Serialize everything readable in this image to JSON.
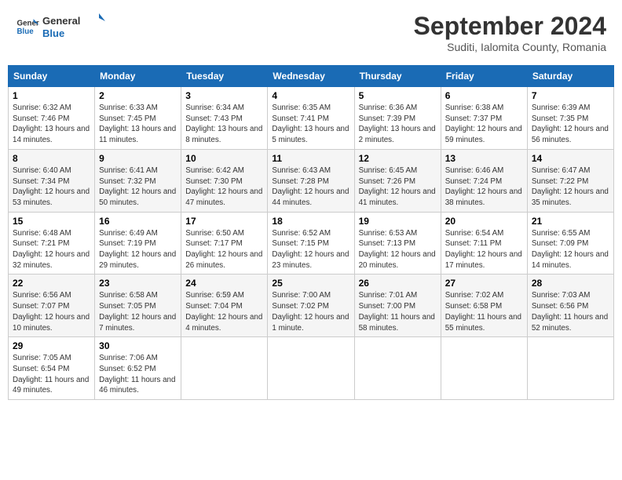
{
  "header": {
    "logo_general": "General",
    "logo_blue": "Blue",
    "month_title": "September 2024",
    "subtitle": "Suditi, Ialomita County, Romania"
  },
  "days_of_week": [
    "Sunday",
    "Monday",
    "Tuesday",
    "Wednesday",
    "Thursday",
    "Friday",
    "Saturday"
  ],
  "weeks": [
    [
      {
        "day": "1",
        "info": "Sunrise: 6:32 AM\nSunset: 7:46 PM\nDaylight: 13 hours and 14 minutes."
      },
      {
        "day": "2",
        "info": "Sunrise: 6:33 AM\nSunset: 7:45 PM\nDaylight: 13 hours and 11 minutes."
      },
      {
        "day": "3",
        "info": "Sunrise: 6:34 AM\nSunset: 7:43 PM\nDaylight: 13 hours and 8 minutes."
      },
      {
        "day": "4",
        "info": "Sunrise: 6:35 AM\nSunset: 7:41 PM\nDaylight: 13 hours and 5 minutes."
      },
      {
        "day": "5",
        "info": "Sunrise: 6:36 AM\nSunset: 7:39 PM\nDaylight: 13 hours and 2 minutes."
      },
      {
        "day": "6",
        "info": "Sunrise: 6:38 AM\nSunset: 7:37 PM\nDaylight: 12 hours and 59 minutes."
      },
      {
        "day": "7",
        "info": "Sunrise: 6:39 AM\nSunset: 7:35 PM\nDaylight: 12 hours and 56 minutes."
      }
    ],
    [
      {
        "day": "8",
        "info": "Sunrise: 6:40 AM\nSunset: 7:34 PM\nDaylight: 12 hours and 53 minutes."
      },
      {
        "day": "9",
        "info": "Sunrise: 6:41 AM\nSunset: 7:32 PM\nDaylight: 12 hours and 50 minutes."
      },
      {
        "day": "10",
        "info": "Sunrise: 6:42 AM\nSunset: 7:30 PM\nDaylight: 12 hours and 47 minutes."
      },
      {
        "day": "11",
        "info": "Sunrise: 6:43 AM\nSunset: 7:28 PM\nDaylight: 12 hours and 44 minutes."
      },
      {
        "day": "12",
        "info": "Sunrise: 6:45 AM\nSunset: 7:26 PM\nDaylight: 12 hours and 41 minutes."
      },
      {
        "day": "13",
        "info": "Sunrise: 6:46 AM\nSunset: 7:24 PM\nDaylight: 12 hours and 38 minutes."
      },
      {
        "day": "14",
        "info": "Sunrise: 6:47 AM\nSunset: 7:22 PM\nDaylight: 12 hours and 35 minutes."
      }
    ],
    [
      {
        "day": "15",
        "info": "Sunrise: 6:48 AM\nSunset: 7:21 PM\nDaylight: 12 hours and 32 minutes."
      },
      {
        "day": "16",
        "info": "Sunrise: 6:49 AM\nSunset: 7:19 PM\nDaylight: 12 hours and 29 minutes."
      },
      {
        "day": "17",
        "info": "Sunrise: 6:50 AM\nSunset: 7:17 PM\nDaylight: 12 hours and 26 minutes."
      },
      {
        "day": "18",
        "info": "Sunrise: 6:52 AM\nSunset: 7:15 PM\nDaylight: 12 hours and 23 minutes."
      },
      {
        "day": "19",
        "info": "Sunrise: 6:53 AM\nSunset: 7:13 PM\nDaylight: 12 hours and 20 minutes."
      },
      {
        "day": "20",
        "info": "Sunrise: 6:54 AM\nSunset: 7:11 PM\nDaylight: 12 hours and 17 minutes."
      },
      {
        "day": "21",
        "info": "Sunrise: 6:55 AM\nSunset: 7:09 PM\nDaylight: 12 hours and 14 minutes."
      }
    ],
    [
      {
        "day": "22",
        "info": "Sunrise: 6:56 AM\nSunset: 7:07 PM\nDaylight: 12 hours and 10 minutes."
      },
      {
        "day": "23",
        "info": "Sunrise: 6:58 AM\nSunset: 7:05 PM\nDaylight: 12 hours and 7 minutes."
      },
      {
        "day": "24",
        "info": "Sunrise: 6:59 AM\nSunset: 7:04 PM\nDaylight: 12 hours and 4 minutes."
      },
      {
        "day": "25",
        "info": "Sunrise: 7:00 AM\nSunset: 7:02 PM\nDaylight: 12 hours and 1 minute."
      },
      {
        "day": "26",
        "info": "Sunrise: 7:01 AM\nSunset: 7:00 PM\nDaylight: 11 hours and 58 minutes."
      },
      {
        "day": "27",
        "info": "Sunrise: 7:02 AM\nSunset: 6:58 PM\nDaylight: 11 hours and 55 minutes."
      },
      {
        "day": "28",
        "info": "Sunrise: 7:03 AM\nSunset: 6:56 PM\nDaylight: 11 hours and 52 minutes."
      }
    ],
    [
      {
        "day": "29",
        "info": "Sunrise: 7:05 AM\nSunset: 6:54 PM\nDaylight: 11 hours and 49 minutes."
      },
      {
        "day": "30",
        "info": "Sunrise: 7:06 AM\nSunset: 6:52 PM\nDaylight: 11 hours and 46 minutes."
      },
      null,
      null,
      null,
      null,
      null
    ]
  ]
}
